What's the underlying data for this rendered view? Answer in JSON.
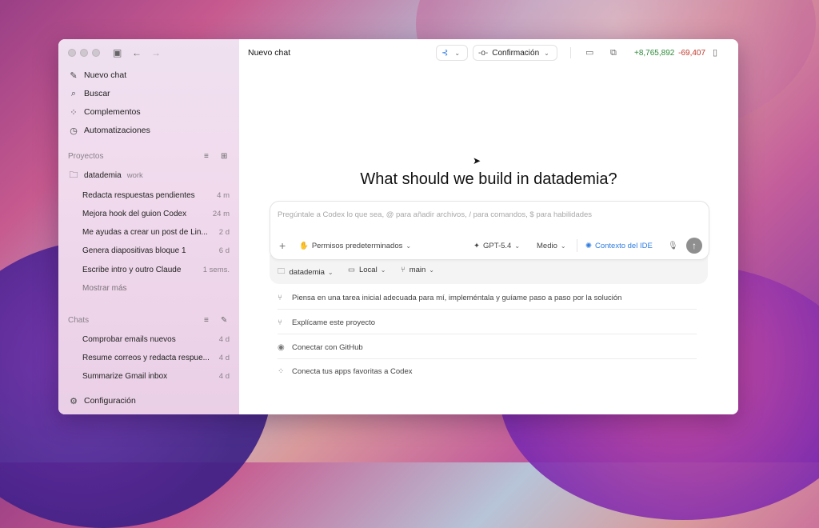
{
  "sidebar": {
    "nav": [
      {
        "label": "Nuevo chat",
        "icon": "edit-icon"
      },
      {
        "label": "Buscar",
        "icon": "search-icon"
      },
      {
        "label": "Complementos",
        "icon": "grid-icon"
      },
      {
        "label": "Automatizaciones",
        "icon": "clock-icon"
      }
    ],
    "projects_label": "Proyectos",
    "project": {
      "name": "datademia",
      "tag": "work"
    },
    "threads": [
      {
        "title": "Redacta respuestas pendientes",
        "time": "4 m"
      },
      {
        "title": "Mejora hook del guion Codex",
        "time": "24 m"
      },
      {
        "title": "Me ayudas a crear un post de Lin...",
        "time": "2 d"
      },
      {
        "title": "Genera diapositivas bloque 1",
        "time": "6 d"
      },
      {
        "title": "Escribe intro y outro Claude",
        "time": "1 sems."
      }
    ],
    "show_more": "Mostrar más",
    "chats_label": "Chats",
    "chats": [
      {
        "title": "Comprobar emails nuevos",
        "time": "4 d"
      },
      {
        "title": "Resume correos y redacta respue...",
        "time": "4 d"
      },
      {
        "title": "Summarize Gmail inbox",
        "time": "4 d"
      }
    ],
    "settings": "Configuración"
  },
  "header": {
    "title": "Nuevo chat",
    "mode": "Confirmación",
    "additions": "+8,765,892",
    "deletions": "-69,407"
  },
  "main": {
    "heading": "What should we build in datademia?",
    "composer_placeholder": "Pregúntale a Codex lo que sea, @ para añadir archivos, / para comandos, $ para habilidades",
    "permissions": "Permisos predeterminados",
    "model": "GPT-5.4",
    "effort": "Medio",
    "ide_context": "Contexto del IDE",
    "project_select": "datademia",
    "env_select": "Local",
    "branch_select": "main",
    "suggestions": [
      {
        "text": "Piensa en una tarea inicial adecuada para mí, impleméntala y guíame paso a paso por la solución",
        "icon": "branch-icon"
      },
      {
        "text": "Explícame este proyecto",
        "icon": "branch-icon"
      },
      {
        "text": "Conectar con GitHub",
        "icon": "github-icon"
      },
      {
        "text": "Conecta tus apps favoritas a Codex",
        "icon": "apps-icon"
      }
    ]
  },
  "colors": {
    "accent": "#2f7de1",
    "additions": "#2e8b3a",
    "deletions": "#c0392b"
  }
}
